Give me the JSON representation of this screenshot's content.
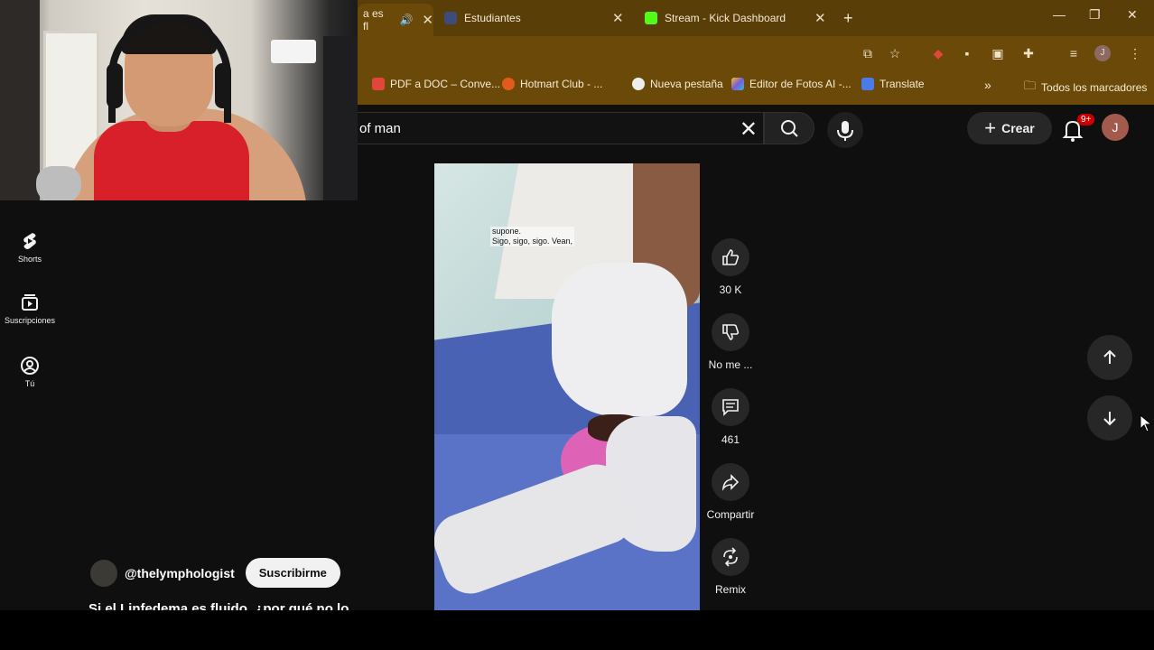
{
  "browser": {
    "tabs": [
      {
        "label": "a es fl",
        "active": true,
        "audio": true
      },
      {
        "label": "Estudiantes",
        "active": false
      },
      {
        "label": "Stream - Kick Dashboard",
        "active": false
      }
    ],
    "new_tab": "+",
    "bookmarks": [
      {
        "label": "PDF a DOC – Conve...",
        "color": "#e0473b"
      },
      {
        "label": "Hotmart Club - ...",
        "color": "#e25a1c"
      },
      {
        "label": "Nueva pestaña",
        "color": "#eeeeee"
      },
      {
        "label": "Editor de Fotos AI -...",
        "color": "#7b5bd6"
      },
      {
        "label": "Translate",
        "color": "#4a7be8"
      }
    ],
    "bookmarks_overflow": "»",
    "all_bookmarks": "Todos los marcadores",
    "profile_initial": "J"
  },
  "youtube": {
    "search_value": "of man",
    "create_label": "Crear",
    "notifications_badge": "9+",
    "avatar_initial": "J",
    "sidebar": [
      {
        "label": "Shorts",
        "icon": "shorts-icon"
      },
      {
        "label": "Suscripciones",
        "icon": "subscriptions-icon"
      },
      {
        "label": "Tú",
        "icon": "you-icon"
      }
    ],
    "channel_handle": "@thelymphologist",
    "subscribe_label": "Suscribirme",
    "video_title": "Si el Linfedema es fluido, ¿por qué no lo",
    "video_caption_line1": "supone.",
    "video_caption_line2": "Sigo, sigo, sigo. Vean,",
    "actions": {
      "like_count": "30 K",
      "dislike_label": "No me ...",
      "comments_count": "461",
      "share_label": "Compartir",
      "remix_label": "Remix"
    }
  },
  "colors": {
    "chrome_bg": "#6b4a09",
    "chrome_tabstrip": "#5a3e07",
    "yt_bg": "#0f0f0f",
    "notify_red": "#cc0000"
  }
}
